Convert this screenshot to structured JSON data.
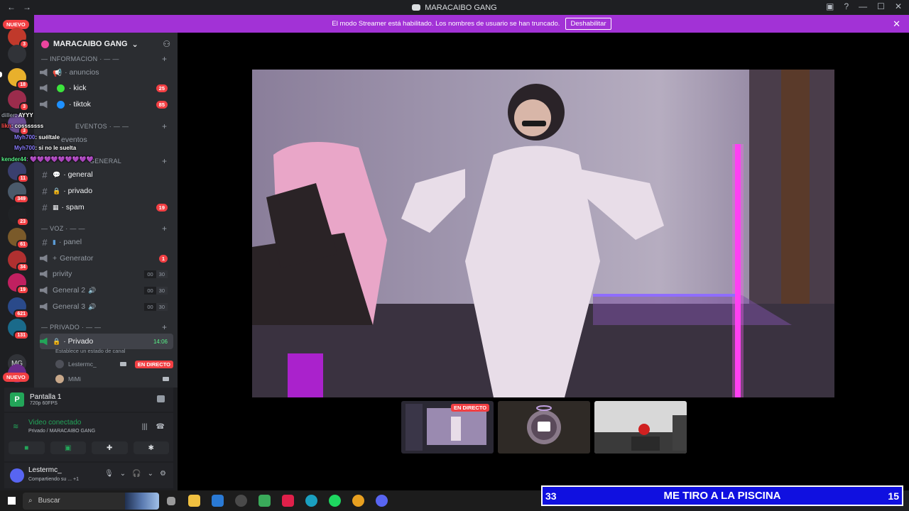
{
  "titlebar": {
    "title": "MARACAIBO GANG"
  },
  "banner": {
    "text": "El modo Streamer está habilitado. Los nombres de usuario se han truncado.",
    "button": "Deshabilitar"
  },
  "rail": {
    "new_top": "NUEVO",
    "new_bottom": "NUEVO",
    "mg_label": "MG",
    "badges": [
      "3",
      "18",
      "3",
      "3",
      "11",
      "349",
      "23",
      "61",
      "34",
      "19",
      "621",
      "131"
    ]
  },
  "server": {
    "name": "MARACAIBO GANG"
  },
  "categories": {
    "info": "— INFORMACION · — —",
    "eventos": "EVENTOS · — —",
    "general": "GENERAL",
    "voz": "— VOZ · — —",
    "privado": "— PRIVADO · — —"
  },
  "channels": {
    "anuncios": "· anuncios",
    "kick": "· kick",
    "kick_count": "25",
    "tiktok": "· tiktok",
    "tiktok_count": "85",
    "eventos": "eventos",
    "general": "· general",
    "privado": "· privado",
    "spam": "· spam",
    "spam_count": "19",
    "panel": "· panel",
    "generator": "Generator",
    "generator_count": "1",
    "privity": "privity",
    "privity_a": "00",
    "privity_b": "30",
    "general2": "General 2",
    "general2_a": "00",
    "general2_b": "30",
    "general3": "General 3",
    "general3_a": "00",
    "general3_b": "30",
    "privado_voice": "· Privado",
    "privado_time": "14:06",
    "privado_status": "Establece un estado de canal"
  },
  "members": [
    {
      "name": "Lestermc_",
      "badge": "EN DIRECTO"
    },
    {
      "name": "MiMi"
    }
  ],
  "chat_overlay": [
    {
      "user": "diller",
      "text": ": AYYY",
      "color": "#949ba4"
    },
    {
      "user": "likn",
      "text": ": cosssssss",
      "color": "#ff4d4d"
    },
    {
      "user": "Myh700",
      "text": ": suéltale",
      "color": "#8a7cff"
    },
    {
      "user": "Myh700",
      "text": ": si no le suelta",
      "color": "#8a7cff"
    },
    {
      "user": "kender44",
      "text": ": 💜💜💜💜💜💜💜💜💜",
      "color": "#57f287"
    }
  ],
  "screen_share": {
    "title": "Pantalla 1",
    "quality": "720p 60FPS",
    "icon_letter": "P"
  },
  "voice": {
    "status": "Video conectado",
    "channel": "Privado / MARACAIBO GANG"
  },
  "user": {
    "name": "Lestermc_",
    "status": "Compartiendo su ...",
    "extra": "+1"
  },
  "stage": {
    "live_badge": "EN DIRECTO"
  },
  "ticker": {
    "left": "33",
    "text": "ME TIRO A LA PISCINA",
    "right": "15"
  },
  "taskbar": {
    "search": "Buscar"
  },
  "colors": {
    "accent": "#a232d6",
    "live": "#f23f43",
    "connected": "#23a559",
    "ticker": "#1010e0"
  }
}
